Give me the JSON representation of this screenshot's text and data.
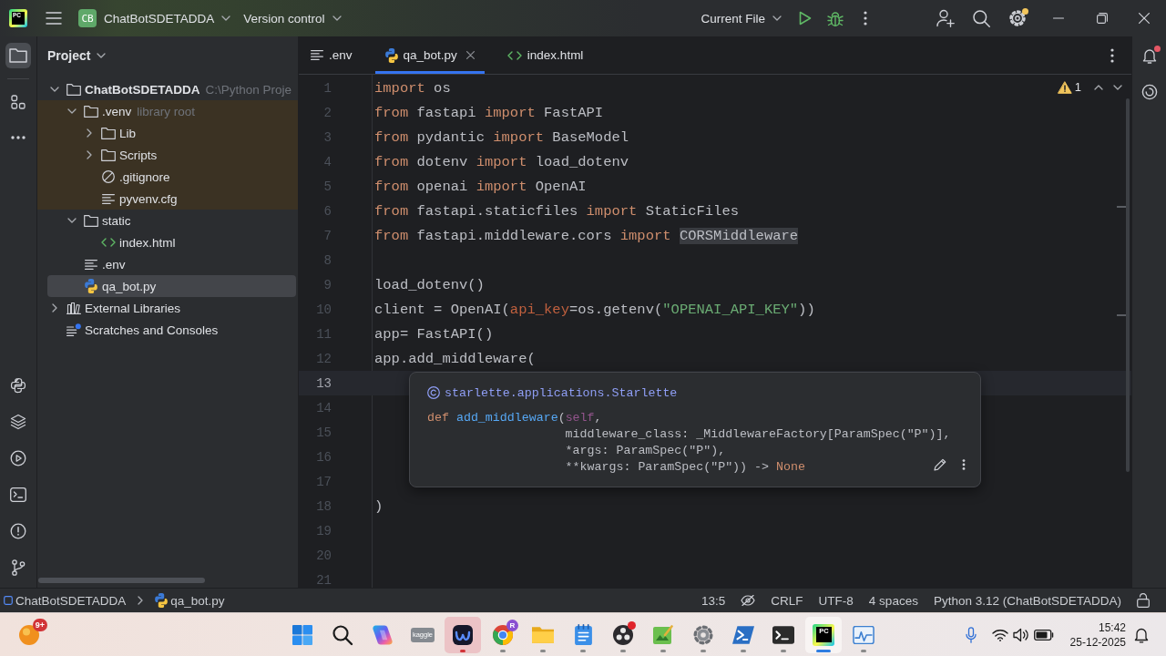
{
  "title_bar": {
    "logo": "PC",
    "project_initials": "CB",
    "project": "ChatBotSDETADDA",
    "vcs": "Version control",
    "run_config": "Current File",
    "settings_badge": true
  },
  "tool_strip": {
    "top": [
      {
        "kind": "project",
        "selected": true
      },
      {
        "kind": "structure",
        "selected": false
      },
      {
        "kind": "more",
        "selected": false
      }
    ],
    "bottom": [
      {
        "kind": "python_console",
        "selected": false
      },
      {
        "kind": "layers",
        "selected": false
      },
      {
        "kind": "services",
        "selected": false
      },
      {
        "kind": "terminal",
        "selected": false
      },
      {
        "kind": "problems",
        "selected": false
      },
      {
        "kind": "git",
        "selected": false
      }
    ]
  },
  "project_panel": {
    "title": "Project",
    "tree": [
      {
        "kind": "project",
        "label": "ChatBotSDETADDA",
        "hint": "C:\\Python Proje",
        "expanded": true,
        "selected": false,
        "library_root": false,
        "children": [
          {
            "kind": "folder",
            "label": ".venv",
            "hint": "library root",
            "expanded": true,
            "selected": false,
            "library_root": true,
            "children": [
              {
                "kind": "folder",
                "label": "Lib",
                "expanded": false,
                "selected": false,
                "library_root": false
              },
              {
                "kind": "folder",
                "label": "Scripts",
                "expanded": false,
                "selected": false,
                "library_root": false
              },
              {
                "kind": "ignore",
                "label": ".gitignore",
                "selected": false,
                "library_root": false
              },
              {
                "kind": "text",
                "label": "pyvenv.cfg",
                "selected": false,
                "library_root": false
              }
            ]
          },
          {
            "kind": "folder",
            "label": "static",
            "expanded": true,
            "selected": false,
            "library_root": false,
            "children": [
              {
                "kind": "html",
                "label": "index.html",
                "selected": false,
                "library_root": false
              }
            ]
          },
          {
            "kind": "text",
            "label": ".env",
            "selected": false,
            "library_root": false
          },
          {
            "kind": "python",
            "label": "qa_bot.py",
            "selected": true,
            "library_root": false
          }
        ]
      },
      {
        "kind": "libraries",
        "label": "External Libraries",
        "expanded": false,
        "selected": false,
        "library_root": false
      },
      {
        "kind": "scratches",
        "label": "Scratches and Consoles",
        "selected": false,
        "library_root": false
      }
    ]
  },
  "editor": {
    "tabs": [
      {
        "kind": "text",
        "label": ".env",
        "selected": false
      },
      {
        "kind": "python",
        "label": "qa_bot.py",
        "selected": true
      },
      {
        "kind": "html",
        "label": "index.html",
        "selected": false
      }
    ],
    "inspection_count": "1",
    "lines": [
      {
        "number": "1",
        "current": false,
        "tokens": [
          {
            "kind": "kw",
            "text": "import"
          },
          {
            "kind": "id",
            "text": " os"
          }
        ]
      },
      {
        "number": "2",
        "current": false,
        "tokens": [
          {
            "kind": "kw",
            "text": "from"
          },
          {
            "kind": "id",
            "text": " fastapi "
          },
          {
            "kind": "kw",
            "text": "import"
          },
          {
            "kind": "id",
            "text": " FastAPI"
          }
        ]
      },
      {
        "number": "3",
        "current": false,
        "tokens": [
          {
            "kind": "kw",
            "text": "from"
          },
          {
            "kind": "id",
            "text": " pydantic "
          },
          {
            "kind": "kw",
            "text": "import"
          },
          {
            "kind": "id",
            "text": " BaseModel"
          }
        ]
      },
      {
        "number": "4",
        "current": false,
        "tokens": [
          {
            "kind": "kw",
            "text": "from"
          },
          {
            "kind": "id",
            "text": " dotenv "
          },
          {
            "kind": "kw",
            "text": "import"
          },
          {
            "kind": "id",
            "text": " load_dotenv"
          }
        ]
      },
      {
        "number": "5",
        "current": false,
        "tokens": [
          {
            "kind": "kw",
            "text": "from"
          },
          {
            "kind": "id",
            "text": " openai "
          },
          {
            "kind": "kw",
            "text": "import"
          },
          {
            "kind": "id",
            "text": " OpenAI"
          }
        ]
      },
      {
        "number": "6",
        "current": false,
        "tokens": [
          {
            "kind": "kw",
            "text": "from"
          },
          {
            "kind": "id",
            "text": " fastapi.staticfiles "
          },
          {
            "kind": "kw",
            "text": "import"
          },
          {
            "kind": "id",
            "text": " StaticFiles"
          }
        ]
      },
      {
        "number": "7",
        "current": false,
        "tokens": [
          {
            "kind": "kw",
            "text": "from"
          },
          {
            "kind": "id",
            "text": " fastapi.middleware.cors "
          },
          {
            "kind": "kw",
            "text": "import "
          },
          {
            "kind": "use",
            "text": "CORSMiddleware"
          }
        ]
      },
      {
        "number": "8",
        "current": false
      },
      {
        "number": "9",
        "current": false,
        "tokens": [
          {
            "kind": "id",
            "text": "load_dotenv()"
          }
        ]
      },
      {
        "number": "10",
        "current": false,
        "tokens": [
          {
            "kind": "id",
            "text": "client = OpenAI("
          },
          {
            "kind": "arg",
            "text": "api_key"
          },
          {
            "kind": "id",
            "text": "=os.getenv("
          },
          {
            "kind": "str",
            "text": "\"OPENAI_API_KEY\""
          },
          {
            "kind": "id",
            "text": "))"
          }
        ]
      },
      {
        "number": "11",
        "current": false,
        "tokens": [
          {
            "kind": "id",
            "text": "app= FastAPI()"
          }
        ]
      },
      {
        "number": "12",
        "current": false,
        "tokens": [
          {
            "kind": "id",
            "text": "app.add_middleware("
          }
        ]
      },
      {
        "number": "13",
        "current": true
      },
      {
        "number": "14",
        "current": false
      },
      {
        "number": "15",
        "current": false
      },
      {
        "number": "16",
        "current": false
      },
      {
        "number": "17",
        "current": false
      },
      {
        "number": "18",
        "current": false,
        "tokens": [
          {
            "kind": "id",
            "text": ")"
          }
        ]
      },
      {
        "number": "19",
        "current": false
      },
      {
        "number": "20",
        "current": false
      },
      {
        "number": "21",
        "current": false
      }
    ],
    "quick_doc": {
      "class_path": "starlette.applications.Starlette",
      "head": [
        {
          "kind": "kw",
          "text": "def "
        },
        {
          "kind": "fn",
          "text": "add_middleware"
        },
        {
          "kind": "id",
          "text": "("
        }
      ],
      "params": [
        [
          {
            "kind": "self",
            "text": "self"
          },
          {
            "kind": "id",
            "text": ","
          }
        ],
        [
          {
            "kind": "id",
            "text": "middleware_class: _MiddlewareFactory[ParamSpec(\"P\")],"
          }
        ],
        [
          {
            "kind": "id",
            "text": "*args: ParamSpec(\"P\"),"
          }
        ],
        [
          {
            "kind": "id",
            "text": "**kwargs: ParamSpec(\"P\")) -> "
          },
          {
            "kind": "kw",
            "text": "None"
          }
        ]
      ]
    }
  },
  "right_strip": {
    "notifications_unread": true
  },
  "status_bar": {
    "breadcrumbs": [
      {
        "kind": "module",
        "label": "ChatBotSDETADDA"
      },
      {
        "kind": "python",
        "label": "qa_bot.py"
      }
    ],
    "caret": "13:5",
    "line_separator": "CRLF",
    "encoding": "UTF-8",
    "indent": "4 spaces",
    "interpreter": "Python 3.12 (ChatBotSDETADDA)",
    "read_only": false
  },
  "taskbar": {
    "widgets_badge": "9+",
    "apps": [
      {
        "kind": "start",
        "running": false,
        "active": false,
        "flashing": false,
        "alert": false
      },
      {
        "kind": "search",
        "running": false,
        "active": false,
        "flashing": false,
        "alert": false
      },
      {
        "kind": "copilot",
        "running": false,
        "active": false,
        "flashing": false,
        "alert": false
      },
      {
        "kind": "kaggle",
        "label": "kaggle",
        "running": false,
        "active": false,
        "flashing": false,
        "alert": false
      },
      {
        "kind": "meeting",
        "running": true,
        "active": false,
        "flashing": true,
        "alert": false
      },
      {
        "kind": "chrome",
        "badge": "R",
        "running": true,
        "active": false,
        "flashing": false,
        "alert": false
      },
      {
        "kind": "explorer",
        "running": true,
        "active": false,
        "flashing": false,
        "alert": false
      },
      {
        "kind": "notepad",
        "running": true,
        "active": false,
        "flashing": false,
        "alert": false
      },
      {
        "kind": "obs",
        "running": true,
        "active": false,
        "flashing": false,
        "alert": true
      },
      {
        "kind": "greenshot",
        "running": true,
        "active": false,
        "flashing": false,
        "alert": false
      },
      {
        "kind": "settings",
        "running": true,
        "active": false,
        "flashing": false,
        "alert": false
      },
      {
        "kind": "powershell",
        "running": true,
        "active": false,
        "flashing": false,
        "alert": false
      },
      {
        "kind": "terminal",
        "running": true,
        "active": false,
        "flashing": false,
        "alert": false
      },
      {
        "kind": "pycharm",
        "label": "PC",
        "running": true,
        "active": true,
        "flashing": false,
        "alert": false
      },
      {
        "kind": "monitor",
        "running": true,
        "active": false,
        "flashing": false,
        "alert": false
      }
    ],
    "time": "15:42",
    "date": "25-12-2025"
  }
}
